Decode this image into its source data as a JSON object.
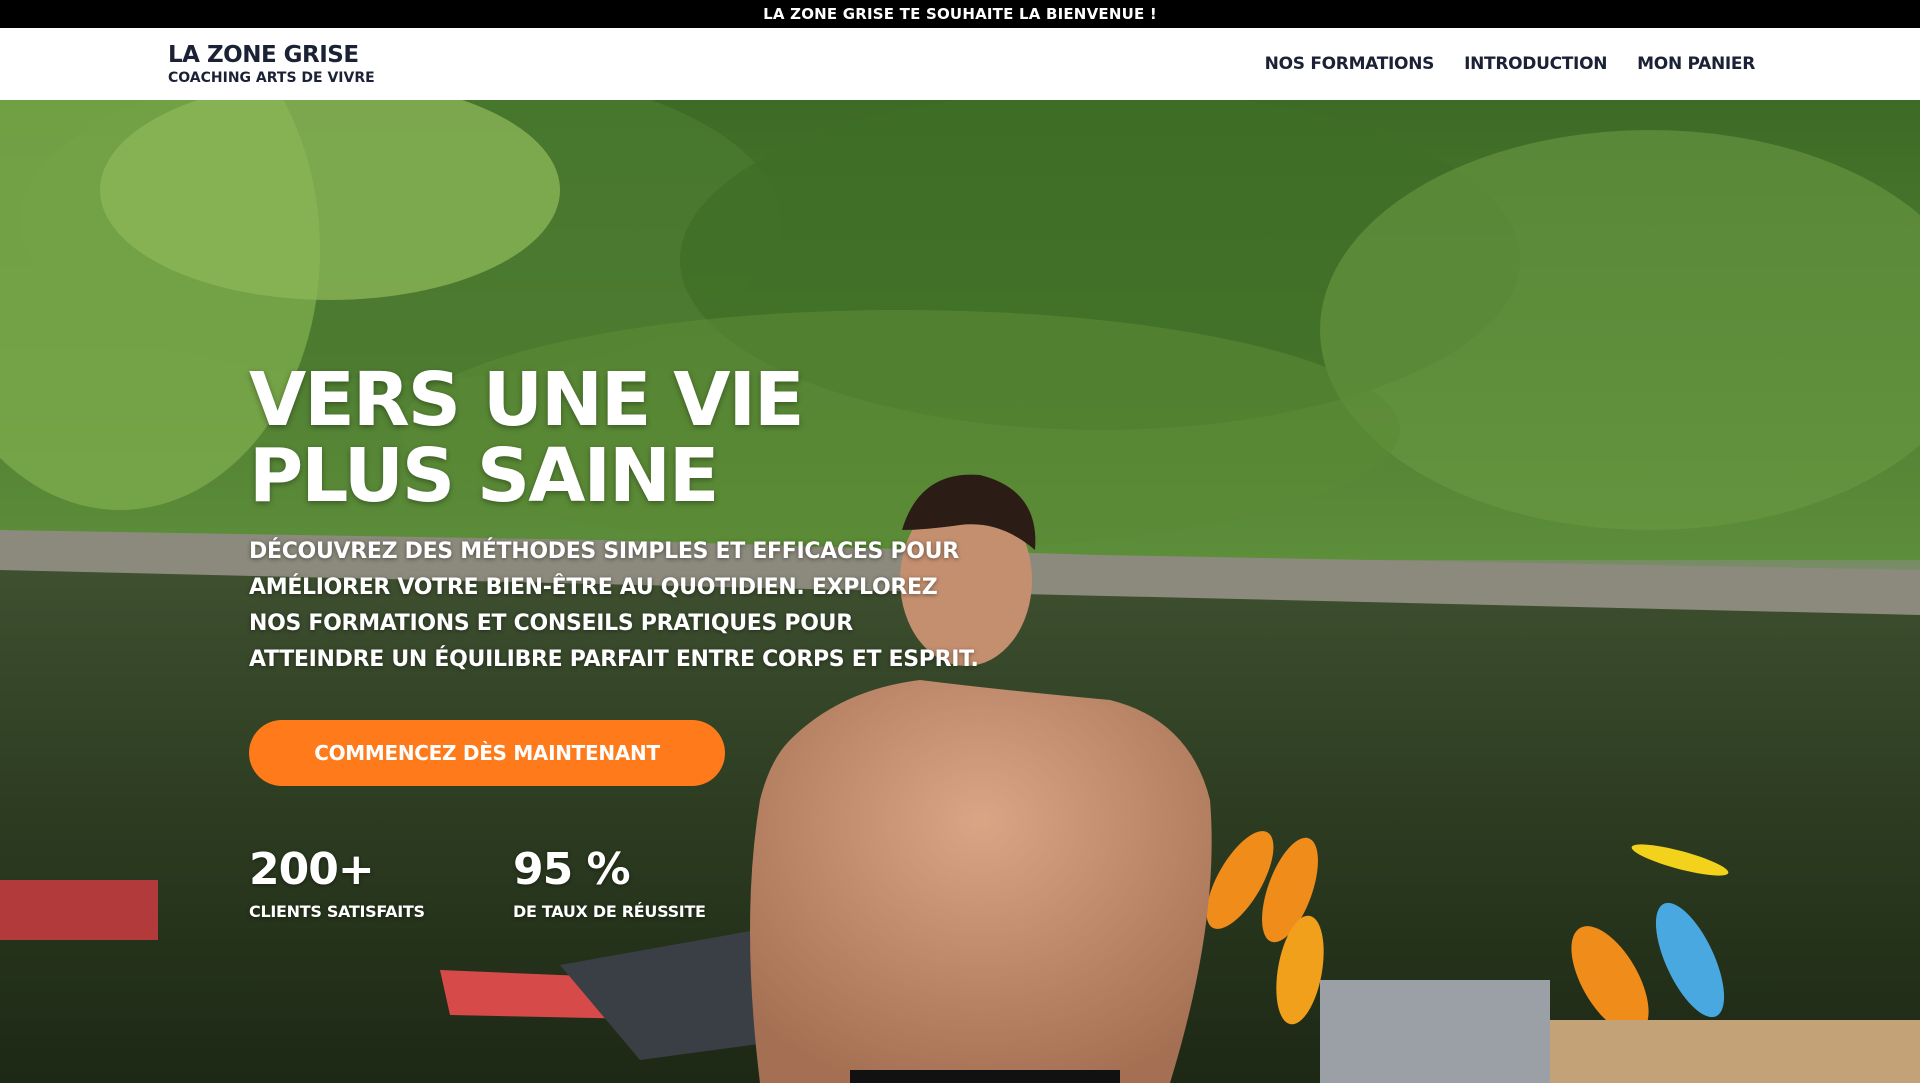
{
  "announcement": "LA ZONE GRISE TE SOUHAITE LA BIENVENUE !",
  "brand": {
    "title": "LA ZONE GRISE",
    "subtitle": "COACHING ARTS DE VIVRE"
  },
  "nav": {
    "items": [
      {
        "label": "NOS FORMATIONS"
      },
      {
        "label": "INTRODUCTION"
      },
      {
        "label": "MON PANIER"
      }
    ]
  },
  "hero": {
    "title_line1": "VERS UNE VIE",
    "title_line2": "PLUS SAINE",
    "description_lines": [
      "DÉCOUVREZ DES MÉTHODES SIMPLES ET EFFICACES POUR",
      "AMÉLIORER VOTRE BIEN-ÊTRE AU QUOTIDIEN. EXPLOREZ",
      "NOS FORMATIONS ET CONSEILS PRATIQUES POUR",
      "ATTEINDRE UN ÉQUILIBRE PARFAIT ENTRE CORPS ET ESPRIT."
    ],
    "cta_label": "COMMENCEZ DÈS MAINTENANT",
    "stats": [
      {
        "value": "200+",
        "label": "CLIENTS SATISFAITS"
      },
      {
        "value": "95 %",
        "label": "DE TAUX DE RÉUSSITE"
      }
    ]
  },
  "colors": {
    "accent": "#ff7a1a",
    "brand_text": "#1c2235",
    "announcement_bg": "#000000"
  }
}
